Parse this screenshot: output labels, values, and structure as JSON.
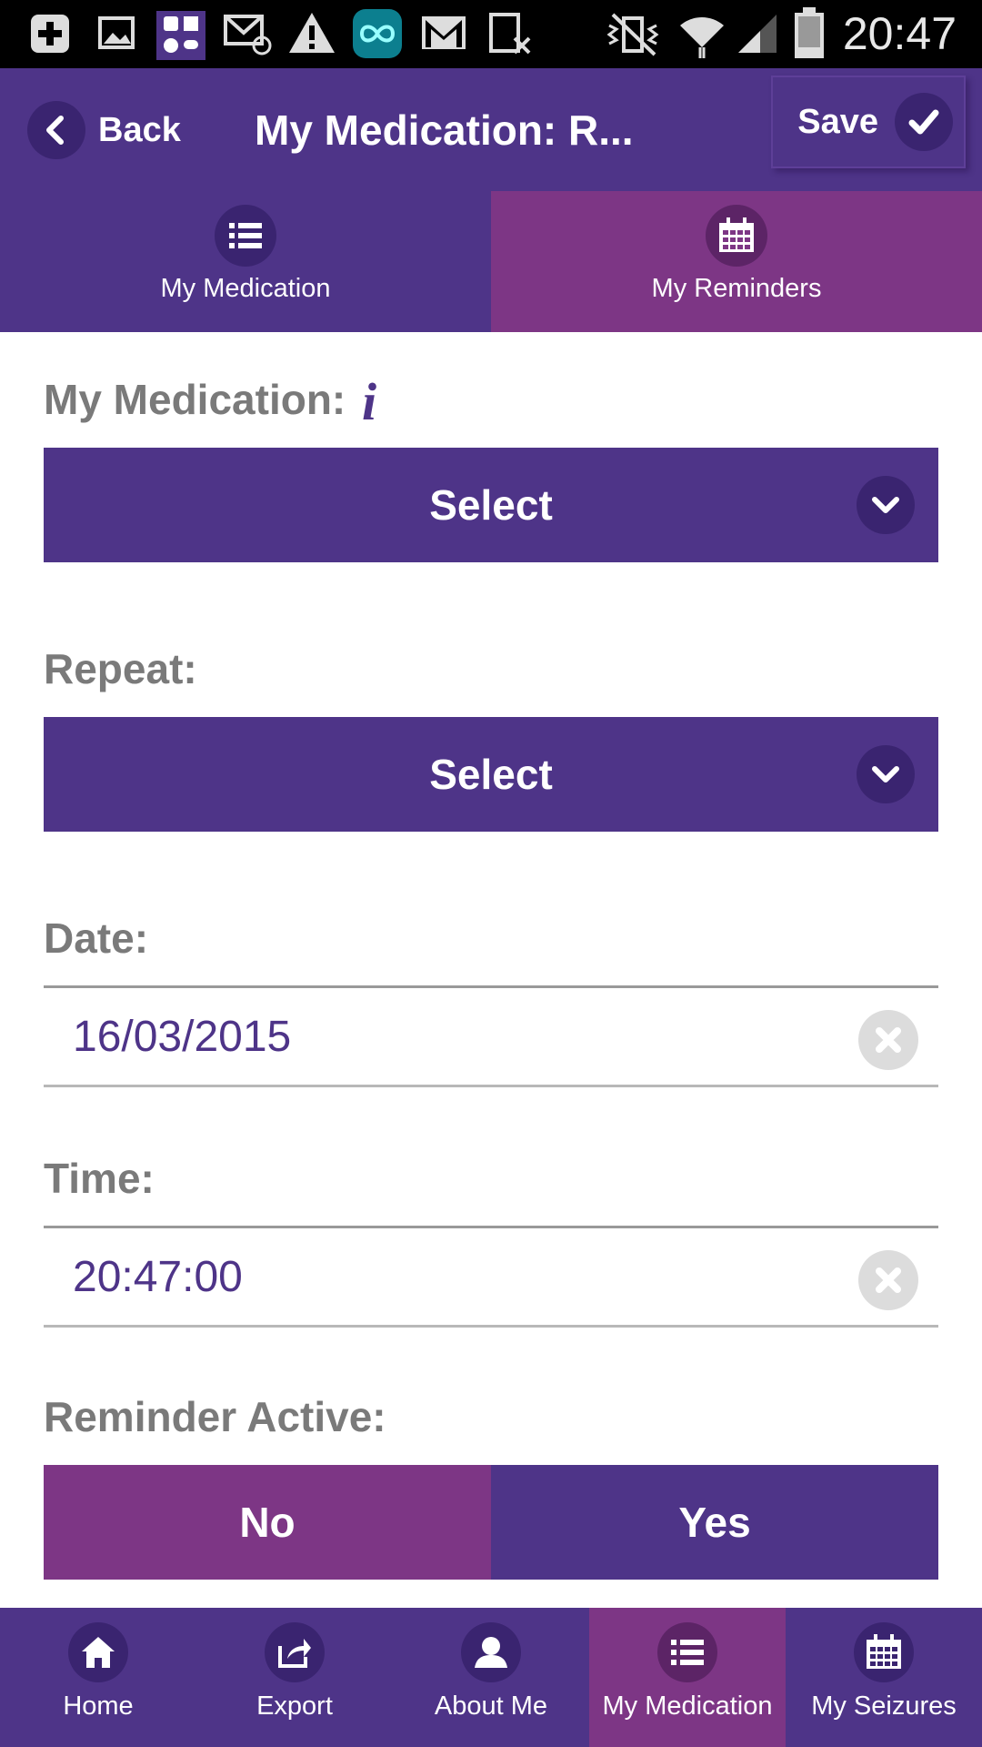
{
  "status_bar": {
    "time": "20:47",
    "icons": [
      "add-box-icon",
      "image-icon",
      "medication-app-icon",
      "email-at-icon",
      "warning-icon",
      "infinity-app-icon",
      "gmail-icon",
      "sim-off-icon",
      "vibrate-mute-icon",
      "wifi-icon",
      "signal-icon",
      "battery-icon"
    ]
  },
  "header": {
    "back_label": "Back",
    "title": "My Medication: R...",
    "save_label": "Save"
  },
  "tabs": [
    {
      "label": "My Medication",
      "icon": "list-icon"
    },
    {
      "label": "My Reminders",
      "icon": "calendar-icon",
      "active": true
    }
  ],
  "form": {
    "medication_label": "My Medication:",
    "medication_value": "Select",
    "repeat_label": "Repeat:",
    "repeat_value": "Select",
    "date_label": "Date:",
    "date_value": "16/03/2015",
    "time_label": "Time:",
    "time_value": "20:47:00",
    "reminder_label": "Reminder Active:",
    "reminder_options": [
      "No",
      "Yes"
    ],
    "reminder_selected": "No"
  },
  "bottom_nav": [
    {
      "label": "Home",
      "icon": "home-icon"
    },
    {
      "label": "Export",
      "icon": "export-icon"
    },
    {
      "label": "About Me",
      "icon": "person-icon"
    },
    {
      "label": "My Medication",
      "icon": "list-icon",
      "active": true
    },
    {
      "label": "My Seizures",
      "icon": "calendar-icon"
    }
  ],
  "colors": {
    "primary": "#4e3488",
    "accent": "#7d3685",
    "label_gray": "#7a7a7a"
  }
}
